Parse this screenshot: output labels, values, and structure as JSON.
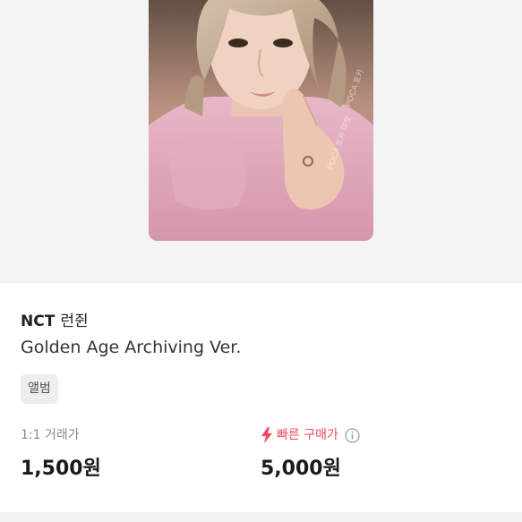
{
  "product": {
    "group": "NCT",
    "member": "런쥔",
    "version": "Golden Age Archiving Ver.",
    "tag": "앨범",
    "image": {
      "description_icon": "photocard-image"
    }
  },
  "pricing": {
    "trade": {
      "label": "1:1 거래가",
      "value": "1,500원"
    },
    "quick_buy": {
      "label": "빠른 구매가",
      "value": "5,000원",
      "icon": "lightning-icon",
      "info_icon": "info-icon"
    }
  },
  "colors": {
    "accent_red": "#f5455c",
    "hero_bg": "#f4f4f4",
    "tag_bg": "#eeeeee"
  }
}
